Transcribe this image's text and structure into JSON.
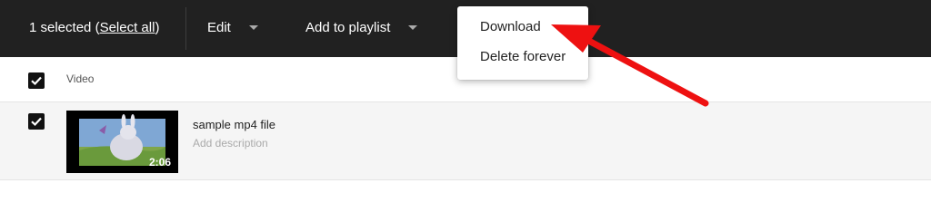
{
  "toolbar": {
    "selection_count": "1 selected",
    "select_all_open": "(",
    "select_all_label": "Select all",
    "select_all_close": ")",
    "edit_label": "Edit",
    "add_to_playlist_label": "Add to playlist"
  },
  "dropdown_menu": {
    "items": [
      {
        "label": "Download"
      },
      {
        "label": "Delete forever"
      }
    ]
  },
  "table": {
    "header": {
      "column_label": "Video",
      "checked": true
    },
    "rows": [
      {
        "checked": true,
        "title": "sample mp4 file",
        "description_placeholder": "Add description",
        "duration": "2:06"
      }
    ]
  },
  "colors": {
    "toolbar_bg": "#212121",
    "annotation_arrow": "#ee1111",
    "row_bg": "#f5f5f5"
  },
  "icons": [
    "checkbox-checked-icon",
    "dropdown-caret-icon",
    "annotation-arrow"
  ]
}
